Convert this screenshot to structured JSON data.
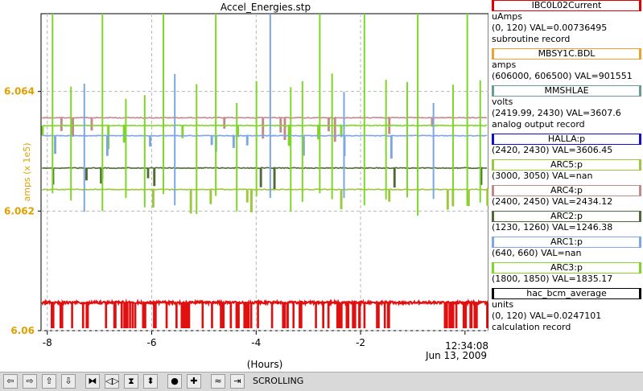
{
  "chart_data": {
    "type": "line",
    "title": "Accel_Energies.stp",
    "ylabel": "amps (x 1e5)",
    "xlabel": "(Hours)",
    "xlim": [
      -8.12,
      0.45
    ],
    "ylim": [
      6.06,
      6.0653
    ],
    "yticks": [
      "6.064",
      "6.062",
      "6.06"
    ],
    "ytick_values": [
      6.064,
      6.062,
      6.06
    ],
    "xticks": [
      "-8",
      "-6",
      "-4",
      "-2"
    ],
    "xtick_values": [
      -8,
      -6,
      -4,
      -2
    ],
    "time_label": "12:34:08",
    "date_label": "Jun 13, 2009",
    "grid": true,
    "series": [
      {
        "name": "ARC4:p",
        "color": "#c48a8a",
        "baseline": 6.06356
      },
      {
        "name": "ARC3:p",
        "color": "#7fd62a",
        "baseline": 6.06343
      },
      {
        "name": "ARC1:p",
        "color": "#7ea6e0",
        "baseline": 6.06326
      },
      {
        "name": "ARC2:p",
        "color": "#4e6b35",
        "baseline": 6.06272
      },
      {
        "name": "ARC5:p",
        "color": "#9bc83c",
        "baseline": 6.06236
      },
      {
        "name": "IBC0L02Current",
        "color": "#e01010",
        "baseline": 6.06047
      }
    ]
  },
  "legend": [
    {
      "name": "IBC0L02Current",
      "color": "#e00000",
      "lines": [
        "uAmps",
        "(0, 120) VAL=0.00736495",
        "subroutine record"
      ]
    },
    {
      "name": "MBSY1C.BDL",
      "color": "#f0a030",
      "lines": [
        "amps",
        "(606000, 606500) VAL=901551"
      ]
    },
    {
      "name": "MMSHLAE",
      "color": "#6a9a9a",
      "lines": [
        "volts",
        "(2419.99, 2430) VAL=3607.6",
        "analog output record"
      ]
    },
    {
      "name": "HALLA:p",
      "color": "#1010d0",
      "lines": [
        "(2420, 2430) VAL=3606.45"
      ]
    },
    {
      "name": "ARC5:p",
      "color": "#9bc83c",
      "lines": [
        "(3000, 3050) VAL=nan"
      ]
    },
    {
      "name": "ARC4:p",
      "color": "#c48a8a",
      "lines": [
        "(2400, 2450) VAL=2434.12"
      ]
    },
    {
      "name": "ARC2:p",
      "color": "#4e6b35",
      "lines": [
        "(1230, 1260) VAL=1246.38"
      ]
    },
    {
      "name": "ARC1:p",
      "color": "#7ea6e0",
      "lines": [
        "(640, 660) VAL=nan"
      ]
    },
    {
      "name": "ARC3:p",
      "color": "#7fd62a",
      "lines": [
        "(1800, 1850) VAL=1835.17"
      ]
    },
    {
      "name": "hac_bcm_average",
      "color": "#000000",
      "lines": [
        "units",
        "(0, 120) VAL=0.0247101",
        "calculation record"
      ]
    }
  ],
  "toolbar": {
    "buttons": [
      {
        "name": "pan-left-button",
        "glyph": "⇦"
      },
      {
        "name": "pan-right-button",
        "glyph": "⇨"
      },
      {
        "name": "pan-up-button",
        "glyph": "⇧"
      },
      {
        "name": "pan-down-button",
        "glyph": "⇩"
      },
      {
        "name": "zoom-in-x-button",
        "glyph": "⧓"
      },
      {
        "name": "zoom-out-x-button",
        "glyph": "◁▷"
      },
      {
        "name": "zoom-in-y-button",
        "glyph": "⧗"
      },
      {
        "name": "zoom-out-y-button",
        "glyph": "⬍"
      },
      {
        "name": "auto-zoom-button",
        "glyph": "●"
      },
      {
        "name": "add-button",
        "glyph": "✚"
      },
      {
        "name": "mode-button",
        "glyph": "≈"
      },
      {
        "name": "time-button",
        "glyph": "⇥"
      }
    ],
    "status": "SCROLLING"
  }
}
